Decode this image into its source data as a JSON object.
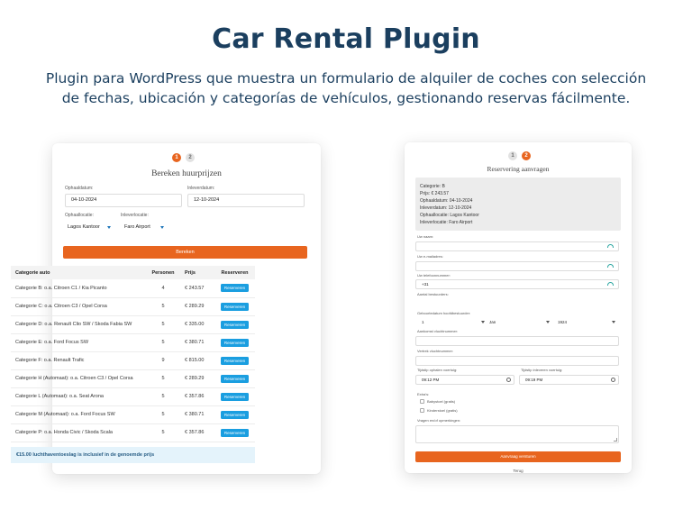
{
  "hero": {
    "title": "Car Rental Plugin",
    "subtitle": "Plugin para WordPress que muestra un formulario de alquiler de coches con selección de fechas, ubicación y categorías de vehículos, gestionando reservas fácilmente."
  },
  "left_form": {
    "steps": [
      "1",
      "2"
    ],
    "active_step": 1,
    "title": "Bereken huurprijzen",
    "pickup_date_label": "Ophaaldatum:",
    "pickup_date_value": "04-10-2024",
    "return_date_label": "Inleverdatum:",
    "return_date_value": "12-10-2024",
    "pickup_location_label": "Ophaallocatie:",
    "pickup_location_value": "Lagos Kantoor",
    "return_location_label": "Inleverlocatie:",
    "return_location_value": "Faro Airport",
    "calculate_label": "Bereken",
    "table_headers": [
      "Categorie auto",
      "Personen",
      "Prijs",
      "Reserveren"
    ],
    "rows": [
      {
        "category": "Categorie B: o.a. Citroen C1 / Kia Picanto",
        "persons": "4",
        "price": "€ 243.57",
        "action": "Reserveren"
      },
      {
        "category": "Categorie C: o.a. Citroen C3 / Opel Corsa",
        "persons": "5",
        "price": "€ 289.29",
        "action": "Reserveren"
      },
      {
        "category": "Categorie D: o.a. Renault Clio SW / Skoda Fabia SW",
        "persons": "5",
        "price": "€ 335.00",
        "action": "Reserveren"
      },
      {
        "category": "Categorie E: o.a. Ford Focus SW",
        "persons": "5",
        "price": "€ 380.71",
        "action": "Reserveren"
      },
      {
        "category": "Categorie F: o.a. Renault Trafic",
        "persons": "9",
        "price": "€ 815.00",
        "action": "Reserveren"
      },
      {
        "category": "Categorie H (Automaat): o.a. Citroen C3 / Opel Corsa",
        "persons": "5",
        "price": "€ 289.29",
        "action": "Reserveren"
      },
      {
        "category": "Categorie L (Automaat): o.a. Seat Arona",
        "persons": "5",
        "price": "€ 357.86",
        "action": "Reserveren"
      },
      {
        "category": "Categorie M (Automaat): o.a. Ford Focus SW",
        "persons": "5",
        "price": "€ 380.71",
        "action": "Reserveren"
      },
      {
        "category": "Categorie P: o.a. Honda Civic / Skoda Scala",
        "persons": "5",
        "price": "€ 357.86",
        "action": "Reserveren"
      }
    ],
    "notice": "€15.00 luchthaventoeslag is inclusief in de genoemde prijs"
  },
  "right_form": {
    "steps": [
      "1",
      "2"
    ],
    "active_step": 2,
    "title": "Reservering aanvragen",
    "summary": [
      "Categorie: B",
      "Prijs: € 243.57",
      "Ophaaldatum: 04-10-2024",
      "Inleverdatum: 12-10-2024",
      "Ophaallocatie: Lagos Kantoor",
      "Inleverlocatie: Faro Airport"
    ],
    "name_label": "Uw naam:",
    "email_label": "Uw e-mailadres:",
    "phone_label": "Uw telefoonnummer:",
    "phone_value": "+31",
    "drivers_label": "Aantal bestuurders:",
    "birthdate_label": "Geboortedatum hoofdbestuurder:",
    "birth_day": "1",
    "birth_month": "Jan",
    "birth_year": "1924",
    "arrival_flight_label": "Aankomst vluchtnummer:",
    "departure_flight_label": "Vertrek vluchtnummer:",
    "pickup_time_label": "Tijdstip ophalen voertuig:",
    "pickup_time_value": "09:12 PM",
    "return_time_label": "Tijdstip inleveren voertuig:",
    "return_time_value": "09:19 PM",
    "extras_label": "Extra's:",
    "extras": [
      "Babystoel (gratis)",
      "Kinderstoel (gratis)"
    ],
    "remarks_label": "Vragen en/of opmerkingen:",
    "submit_label": "Aanvraag versturen",
    "back_label": "Terug"
  },
  "colors": {
    "accent": "#e8651f",
    "reserve_button": "#1a9ee0",
    "title_navy": "#1b3f5f",
    "notice_bg": "#e4f3fb"
  }
}
